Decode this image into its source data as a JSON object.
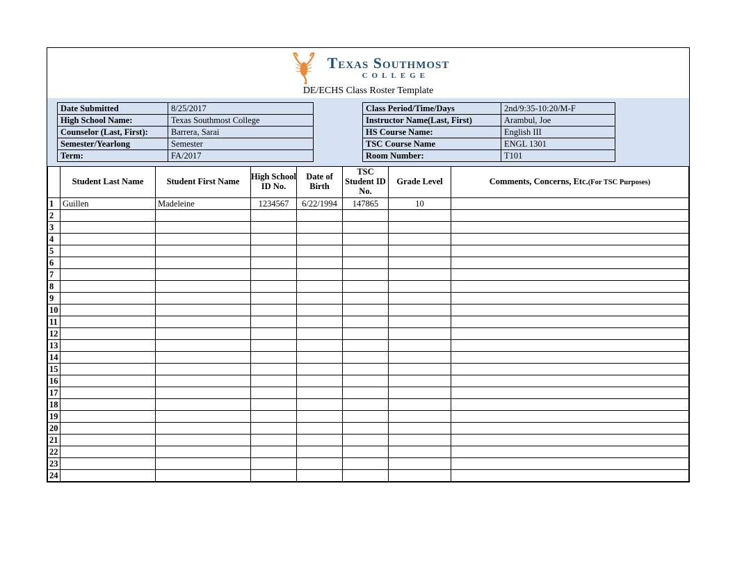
{
  "header": {
    "college_name": "Texas Southmost",
    "college_word": "COLLEGE",
    "subtitle": "DE/ECHS Class Roster Template"
  },
  "info_left": [
    {
      "label": "Date Submitted",
      "value": "8/25/2017"
    },
    {
      "label": "High School Name:",
      "value": "Texas Southmost College"
    },
    {
      "label": "Counselor (Last, First):",
      "value": "Barrera, Sarai"
    },
    {
      "label": "Semester/Yearlong",
      "value": "Semester"
    },
    {
      "label": "Term:",
      "value": "FA/2017"
    }
  ],
  "info_right": [
    {
      "label": "Class Period/Time/Days",
      "value": "2nd/9:35-10:20/M-F"
    },
    {
      "label": "Instructor Name(Last, First)",
      "value": "Arambul, Joe"
    },
    {
      "label": "HS Course Name:",
      "value": "English III"
    },
    {
      "label": "TSC Course Name",
      "value": "ENGL 1301"
    },
    {
      "label": "Room Number:",
      "value": "T101"
    }
  ],
  "columns": {
    "c1": "Student Last Name",
    "c2": "Student First Name",
    "c3": "High School ID No.",
    "c4": "Date of Birth",
    "c5": "TSC Student ID No.",
    "c6": "Grade Level",
    "c7_a": "Comments, Concerns, Etc.",
    "c7_b": "(For TSC Purposes)"
  },
  "rows": [
    {
      "n": "1",
      "last": "Guillen",
      "first": "Madeleine",
      "hsid": "1234567",
      "dob": "6/22/1994",
      "tscid": "147865",
      "grade": "10",
      "comments": ""
    },
    {
      "n": "2",
      "last": "",
      "first": "",
      "hsid": "",
      "dob": "",
      "tscid": "",
      "grade": "",
      "comments": ""
    },
    {
      "n": "3",
      "last": "",
      "first": "",
      "hsid": "",
      "dob": "",
      "tscid": "",
      "grade": "",
      "comments": ""
    },
    {
      "n": "4",
      "last": "",
      "first": "",
      "hsid": "",
      "dob": "",
      "tscid": "",
      "grade": "",
      "comments": ""
    },
    {
      "n": "5",
      "last": "",
      "first": "",
      "hsid": "",
      "dob": "",
      "tscid": "",
      "grade": "",
      "comments": ""
    },
    {
      "n": "6",
      "last": "",
      "first": "",
      "hsid": "",
      "dob": "",
      "tscid": "",
      "grade": "",
      "comments": ""
    },
    {
      "n": "7",
      "last": "",
      "first": "",
      "hsid": "",
      "dob": "",
      "tscid": "",
      "grade": "",
      "comments": ""
    },
    {
      "n": "8",
      "last": "",
      "first": "",
      "hsid": "",
      "dob": "",
      "tscid": "",
      "grade": "",
      "comments": ""
    },
    {
      "n": "9",
      "last": "",
      "first": "",
      "hsid": "",
      "dob": "",
      "tscid": "",
      "grade": "",
      "comments": ""
    },
    {
      "n": "10",
      "last": "",
      "first": "",
      "hsid": "",
      "dob": "",
      "tscid": "",
      "grade": "",
      "comments": ""
    },
    {
      "n": "11",
      "last": "",
      "first": "",
      "hsid": "",
      "dob": "",
      "tscid": "",
      "grade": "",
      "comments": ""
    },
    {
      "n": "12",
      "last": "",
      "first": "",
      "hsid": "",
      "dob": "",
      "tscid": "",
      "grade": "",
      "comments": ""
    },
    {
      "n": "13",
      "last": "",
      "first": "",
      "hsid": "",
      "dob": "",
      "tscid": "",
      "grade": "",
      "comments": ""
    },
    {
      "n": "14",
      "last": "",
      "first": "",
      "hsid": "",
      "dob": "",
      "tscid": "",
      "grade": "",
      "comments": ""
    },
    {
      "n": "15",
      "last": "",
      "first": "",
      "hsid": "",
      "dob": "",
      "tscid": "",
      "grade": "",
      "comments": ""
    },
    {
      "n": "16",
      "last": "",
      "first": "",
      "hsid": "",
      "dob": "",
      "tscid": "",
      "grade": "",
      "comments": ""
    },
    {
      "n": "17",
      "last": "",
      "first": "",
      "hsid": "",
      "dob": "",
      "tscid": "",
      "grade": "",
      "comments": ""
    },
    {
      "n": "18",
      "last": "",
      "first": "",
      "hsid": "",
      "dob": "",
      "tscid": "",
      "grade": "",
      "comments": ""
    },
    {
      "n": "19",
      "last": "",
      "first": "",
      "hsid": "",
      "dob": "",
      "tscid": "",
      "grade": "",
      "comments": ""
    },
    {
      "n": "20",
      "last": "",
      "first": "",
      "hsid": "",
      "dob": "",
      "tscid": "",
      "grade": "",
      "comments": ""
    },
    {
      "n": "21",
      "last": "",
      "first": "",
      "hsid": "",
      "dob": "",
      "tscid": "",
      "grade": "",
      "comments": ""
    },
    {
      "n": "22",
      "last": "",
      "first": "",
      "hsid": "",
      "dob": "",
      "tscid": "",
      "grade": "",
      "comments": ""
    },
    {
      "n": "23",
      "last": "",
      "first": "",
      "hsid": "",
      "dob": "",
      "tscid": "",
      "grade": "",
      "comments": ""
    },
    {
      "n": "24",
      "last": "",
      "first": "",
      "hsid": "",
      "dob": "",
      "tscid": "",
      "grade": "",
      "comments": ""
    }
  ]
}
